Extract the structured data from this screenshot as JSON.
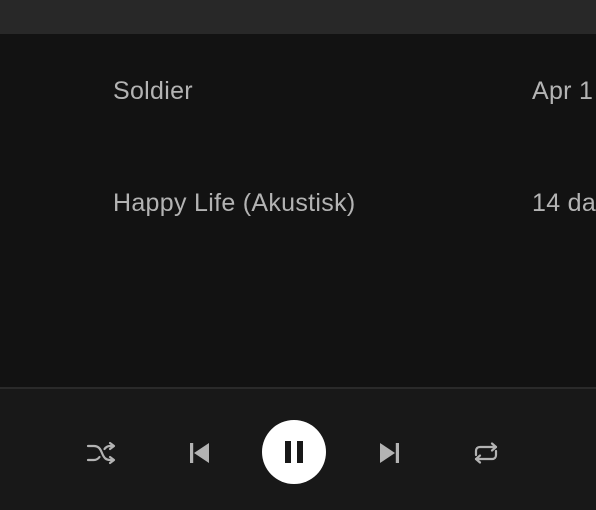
{
  "tracks": [
    {
      "title": "Soldier",
      "date_added": "Apr 1"
    },
    {
      "title": "Happy Life (Akustisk)",
      "date_added": "14 da"
    }
  ],
  "player": {
    "controls": [
      "shuffle-icon",
      "previous-icon",
      "pause-icon",
      "next-icon",
      "repeat-icon"
    ],
    "state": "playing"
  },
  "colors": {
    "background": "#121212",
    "top_bar": "#282828",
    "player_bar": "#181818",
    "text": "#b3b3b3",
    "icon": "#b3b3b3",
    "play_button": "#ffffff"
  }
}
